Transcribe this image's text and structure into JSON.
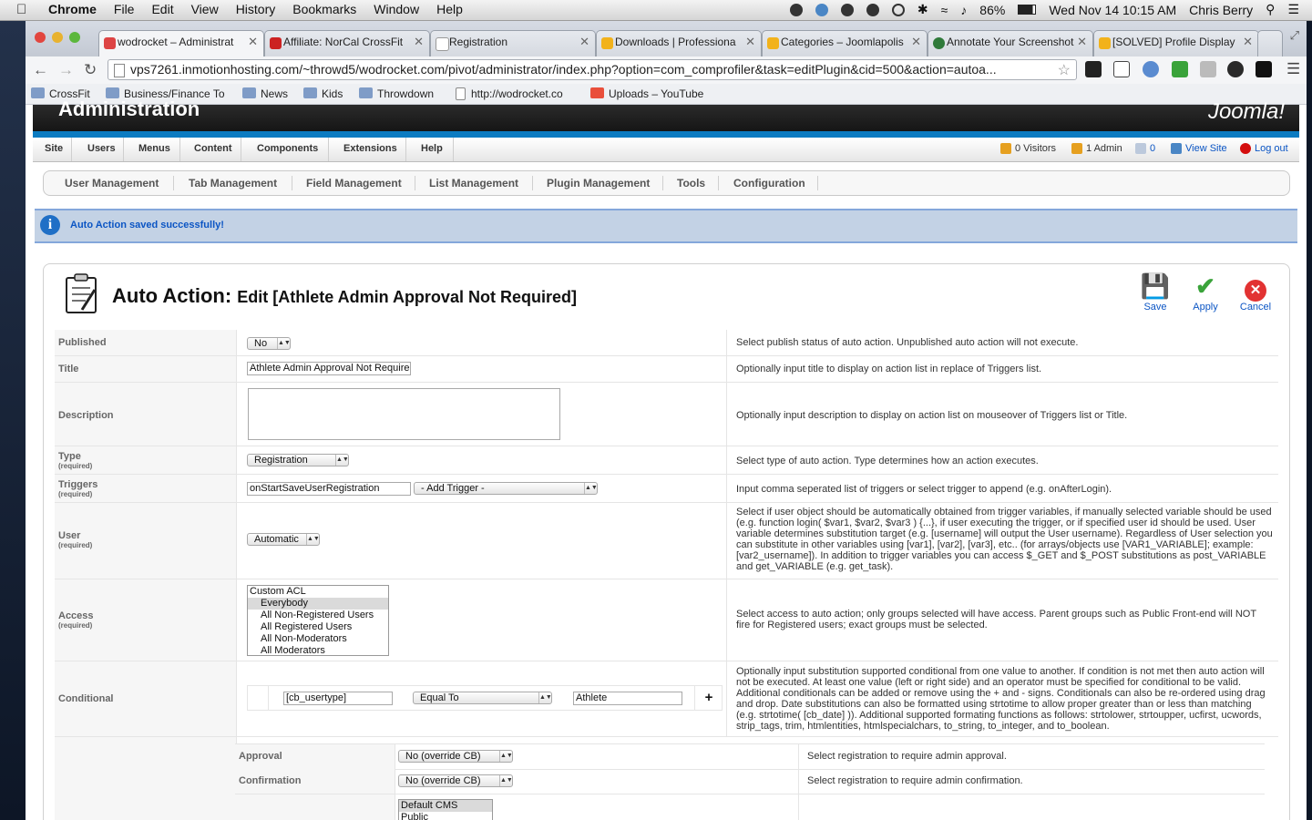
{
  "macmenu": {
    "app": "Chrome",
    "items": [
      "File",
      "Edit",
      "View",
      "History",
      "Bookmarks",
      "Window",
      "Help"
    ],
    "battery": "86%",
    "datetime": "Wed Nov 14  10:15 AM",
    "user": "Chris Berry"
  },
  "tabs": [
    {
      "title": "wodrocket – Administrat",
      "favicon": "#d44"
    },
    {
      "title": "Affiliate: NorCal CrossFit",
      "favicon": "#c22"
    },
    {
      "title": "Registration",
      "favicon": "#fff"
    },
    {
      "title": "Downloads | Professiona",
      "favicon": "#f2b21b"
    },
    {
      "title": "Categories – Joomlapolis",
      "favicon": "#f2b21b"
    },
    {
      "title": "Annotate Your Screenshot",
      "favicon": "#2f7a3a"
    },
    {
      "title": "[SOLVED] Profile Display",
      "favicon": "#f2b21b"
    }
  ],
  "url": "vps7261.inmotionhosting.com/~throwd5/wodrocket.com/pivot/administrator/index.php?option=com_comprofiler&task=editPlugin&cid=500&action=autoa...",
  "bookmarks": [
    "CrossFit",
    "Business/Finance To",
    "News",
    "Kids",
    "Throwdown",
    "http://wodrocket.co",
    "Uploads – YouTube"
  ],
  "admin": {
    "title": "Administration",
    "logo": "Joomla!"
  },
  "menu": {
    "items": [
      "Site",
      "Users",
      "Menus",
      "Content",
      "Components",
      "Extensions",
      "Help"
    ],
    "visitors": "0 Visitors",
    "admins": "1 Admin",
    "messages": "0",
    "view_site": "View Site",
    "logout": "Log out"
  },
  "submenu": [
    "User Management",
    "Tab Management",
    "Field Management",
    "List Management",
    "Plugin Management",
    "Tools",
    "Configuration"
  ],
  "notice": "Auto Action saved successfully!",
  "page": {
    "title": "Auto Action:",
    "subtitle": "Edit [Athlete Admin Approval Not Required]"
  },
  "toolbar": {
    "save": "Save",
    "apply": "Apply",
    "cancel": "Cancel"
  },
  "form": {
    "published": {
      "label": "Published",
      "value": "No",
      "desc": "Select publish status of auto action. Unpublished auto action will not execute."
    },
    "title": {
      "label": "Title",
      "value": "Athlete Admin Approval Not Required",
      "desc": "Optionally input title to display on action list in replace of Triggers list."
    },
    "description": {
      "label": "Description",
      "value": "",
      "desc": "Optionally input description to display on action list on mouseover of Triggers list or Title."
    },
    "type": {
      "label": "Type",
      "req": "(required)",
      "value": "Registration",
      "desc": "Select type of auto action. Type determines how an action executes."
    },
    "triggers": {
      "label": "Triggers",
      "req": "(required)",
      "value": "onStartSaveUserRegistration",
      "add": "- Add Trigger -",
      "desc": "Input comma seperated list of triggers or select trigger to append (e.g. onAfterLogin)."
    },
    "user": {
      "label": "User",
      "req": "(required)",
      "value": "Automatic",
      "desc": "Select if user object should be automatically obtained from trigger variables, if manually selected variable should be used (e.g. function login( $var1, $var2, $var3 ) {...}, if user executing the trigger, or if specified user id should be used. User variable determines substitution target (e.g. [username] will output the User username). Regardless of User selection you can substitute in other variables using [var1], [var2], [var3], etc.. (for arrays/objects use [VAR1_VARIABLE]; example: [var2_username]). In addition to trigger variables you can access $_GET and $_POST substitutions as post_VARIABLE and get_VARIABLE (e.g. get_task)."
    },
    "access": {
      "label": "Access",
      "req": "(required)",
      "group": "Custom ACL",
      "options": [
        "Everybody",
        "All Non-Registered Users",
        "All Registered Users",
        "All Non-Moderators",
        "All Moderators"
      ],
      "desc": "Select access to auto action; only groups selected will have access. Parent groups such as Public Front-end will NOT fire for Registered users; exact groups must be selected."
    },
    "conditional": {
      "label": "Conditional",
      "left": "[cb_usertype]",
      "operator": "Equal To",
      "right": "Athlete",
      "add": "+",
      "desc": "Optionally input substitution supported conditional from one value to another. If condition is not met then auto action will not be executed. At least one value (left or right side) and an operator must be specified for conditional to be valid. Additional conditionals can be added or remove using the + and - signs. Conditionals can also be re-ordered using drag and drop. Date substitutions can also be formatted using strtotime to allow proper greater than or less than matching (e.g. strtotime( [cb_date] )). Additional supported formating functions as follows: strtolower, strtoupper, ucfirst, ucwords, strip_tags, trim, htmlentities, htmlspecialchars, to_string, to_integer, and to_boolean."
    },
    "approval": {
      "label": "Approval",
      "value": "No (override CB)",
      "desc": "Select registration to require admin approval."
    },
    "confirmation": {
      "label": "Confirmation",
      "value": "No (override CB)",
      "desc": "Select registration to require admin confirmation."
    },
    "groups": {
      "options": [
        "Default CMS",
        "Public"
      ]
    }
  }
}
